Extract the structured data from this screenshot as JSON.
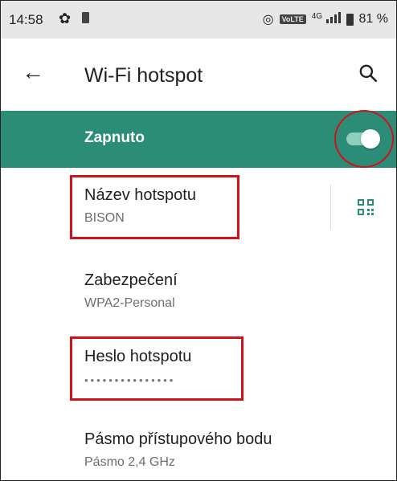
{
  "status_bar": {
    "time": "14:58",
    "network": "4G",
    "volte": "VoLTE",
    "battery": "81 %"
  },
  "app_bar": {
    "title": "Wi-Fi hotspot"
  },
  "switch": {
    "label": "Zapnuto",
    "enabled": true
  },
  "settings": [
    {
      "title": "Název hotspotu",
      "value": "BISON"
    },
    {
      "title": "Zabezpečení",
      "value": "WPA2-Personal"
    },
    {
      "title": "Heslo hotspotu",
      "value": "•••••••••••••••"
    },
    {
      "title": "Pásmo přístupového bodu",
      "value": "Pásmo 2,4 GHz"
    }
  ],
  "icons": {
    "back": "arrow-back-icon",
    "search": "search-icon",
    "qr": "qr-code-icon"
  },
  "colors": {
    "accent": "#2b8c77",
    "highlight": "#d0121b"
  }
}
